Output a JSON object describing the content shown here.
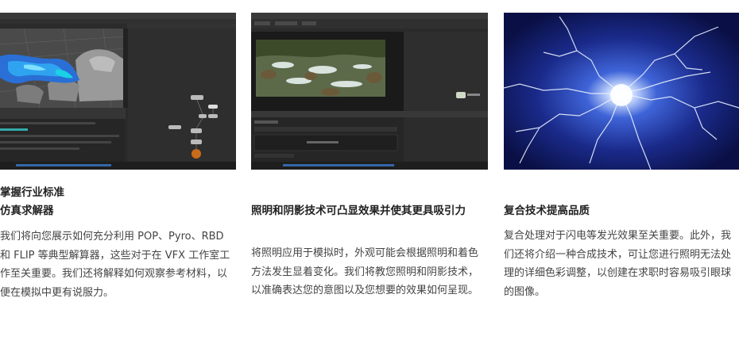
{
  "cards": [
    {
      "image_alt": "Houdini simulation screenshot with network view",
      "title_line1": "掌握行业标准",
      "title_line2": "仿真求解器",
      "body": "我们将向您展示如何充分利用 POP、Pyro、RBD 和 FLIP 等典型解算器，这些对于在 VFX 工作室工作至关重要。我们还将解释如何观察参考材料，以便在模拟中更有说服力。"
    },
    {
      "image_alt": "Compositing software screenshot with river rendering",
      "title": "照明和阴影技术可凸显效果并使其更具吸引力",
      "body": "将照明应用于模拟时，外观可能会根据照明和着色方法发生显着变化。我们将教您照明和阴影技术，以准确表达您的意图以及您想要的效果如何呈现。"
    },
    {
      "image_alt": "Blue lightning electric discharge effect",
      "title": "复合技术提高品质",
      "body": "复合处理对于闪电等发光效果至关重要。此外，我们还将介绍一种合成技术，可让您进行照明无法处理的详细色彩调整，以创建在求职时容易吸引眼球的图像。"
    }
  ]
}
